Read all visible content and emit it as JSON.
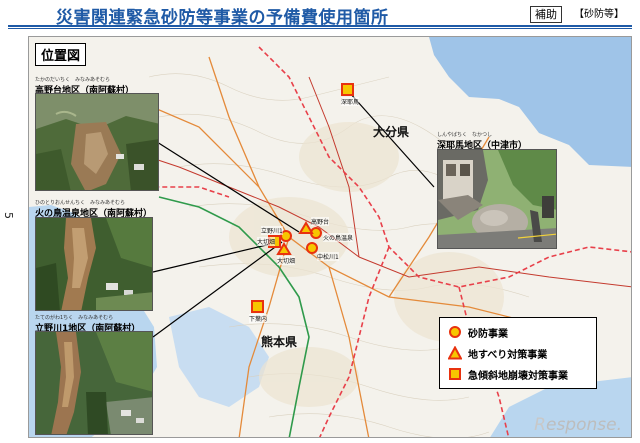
{
  "header": {
    "title": "災害関連緊急砂防等事業の予備費使用箇所",
    "badge": "補助",
    "tag": "【砂防等】"
  },
  "page_number": "5",
  "map": {
    "location_title": "位置図",
    "prefectures": {
      "oita": "大分県",
      "kumamoto": "熊本県"
    },
    "photos": {
      "takanodai": {
        "label": "高野台地区（南阿蘇村）",
        "ruby": "たかのだいちく　みなみあそむら"
      },
      "hinookamiyashiro": {
        "label": "火の鳥温泉地区（南阿蘇村）",
        "ruby": "ひのとりおんせんちく　みなみあそむら"
      },
      "tatenogawa": {
        "label": "立野川1地区（南阿蘇村）",
        "ruby": "たてのがわ1ちく　みなみあそむら"
      },
      "yabakei": {
        "label": "深耶馬地区（中津市）",
        "ruby": "しんやばちく　なかつし"
      }
    },
    "site_labels": {
      "yabakei_site": "深耶馬",
      "takanodai_site": "高野台",
      "tatenogawa_site": "立野川1",
      "okirihata": "大切畑",
      "hinotori": "火の鳥温泉",
      "nakamatsu": "中松川1",
      "ohkibashi": "大切畑",
      "shimonoyama": "下葉内"
    },
    "legend": {
      "item1": "砂防事業",
      "item2": "地すべり対策事業",
      "item3": "急傾斜地崩壊対策事業"
    },
    "colors": {
      "marker_fill": "#f7c600",
      "marker_stroke": "#e8320f",
      "boundary": "#e8404a",
      "title_blue": "#1f5aa6",
      "sea": "#9fc4e8"
    }
  },
  "watermark": {
    "text_r": "R",
    "text_rest": "esponse."
  }
}
